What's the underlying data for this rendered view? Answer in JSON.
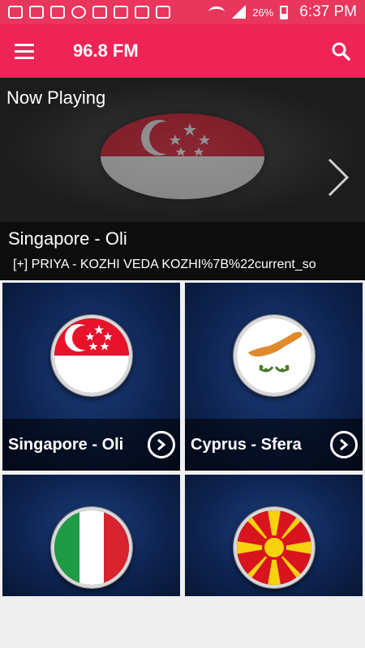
{
  "status_bar": {
    "battery": "26%",
    "time": "6:37 PM"
  },
  "app_bar": {
    "title": "96.8 FM",
    "menu_icon": "hamburger-menu-icon",
    "search_icon": "search-icon"
  },
  "now_playing": {
    "heading": "Now Playing",
    "station": "Singapore - Oli",
    "track": "[+] PRIYA  -  KOZHI VEDA KOZHI%7B%22current_so",
    "flag": "singapore-flag"
  },
  "stations": [
    {
      "name": "Singapore - Oli",
      "flag": "singapore-flag"
    },
    {
      "name": "Cyprus - Sfera",
      "flag": "cyprus-flag"
    },
    {
      "name": "",
      "flag": "italy-flag"
    },
    {
      "name": "",
      "flag": "macedonia-flag"
    }
  ],
  "colors": {
    "accent": "#ee2456",
    "status_bar": "#e8365d",
    "card_bg": "#0d2350"
  }
}
